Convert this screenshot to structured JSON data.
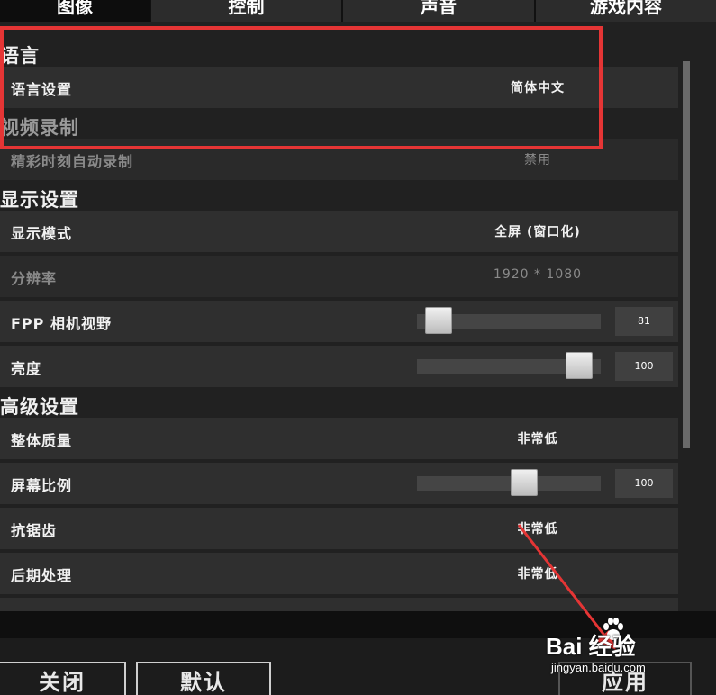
{
  "tabs": [
    {
      "label": "图像",
      "active": true
    },
    {
      "label": "控制",
      "active": false
    },
    {
      "label": "声音",
      "active": false
    },
    {
      "label": "游戏内容",
      "active": false
    }
  ],
  "sections": {
    "language": "语言",
    "video_record": "视频录制",
    "display": "显示设置",
    "advanced": "高级设置"
  },
  "rows": {
    "language_setting": {
      "label": "语言设置",
      "value": "简体中文"
    },
    "highlight_record": {
      "label": "精彩时刻自动录制",
      "value": "禁用"
    },
    "display_mode": {
      "label": "显示模式",
      "value": "全屏 (窗口化)"
    },
    "resolution": {
      "label": "分辨率",
      "value": "1920 * 1080"
    },
    "fpp_fov": {
      "label": "FPP 相机视野",
      "value": "81",
      "level": 0.05
    },
    "brightness": {
      "label": "亮度",
      "value": "100",
      "level": 0.95
    },
    "overall_quality": {
      "label": "整体质量",
      "value": "非常低"
    },
    "screen_scale": {
      "label": "屏幕比例",
      "value": "100",
      "level": 0.6
    },
    "anti_aliasing": {
      "label": "抗锯齿",
      "value": "非常低"
    },
    "post_processing": {
      "label": "后期处理",
      "value": "非常低"
    }
  },
  "buttons": {
    "close": "关闭",
    "default": "默认",
    "apply": "应用"
  },
  "watermark": {
    "brand": "Bai 经验",
    "url": "jingyan.baidu.com"
  },
  "colors": {
    "highlight": "#e53535",
    "panel": "#212121",
    "row": "#2f2f2f"
  }
}
